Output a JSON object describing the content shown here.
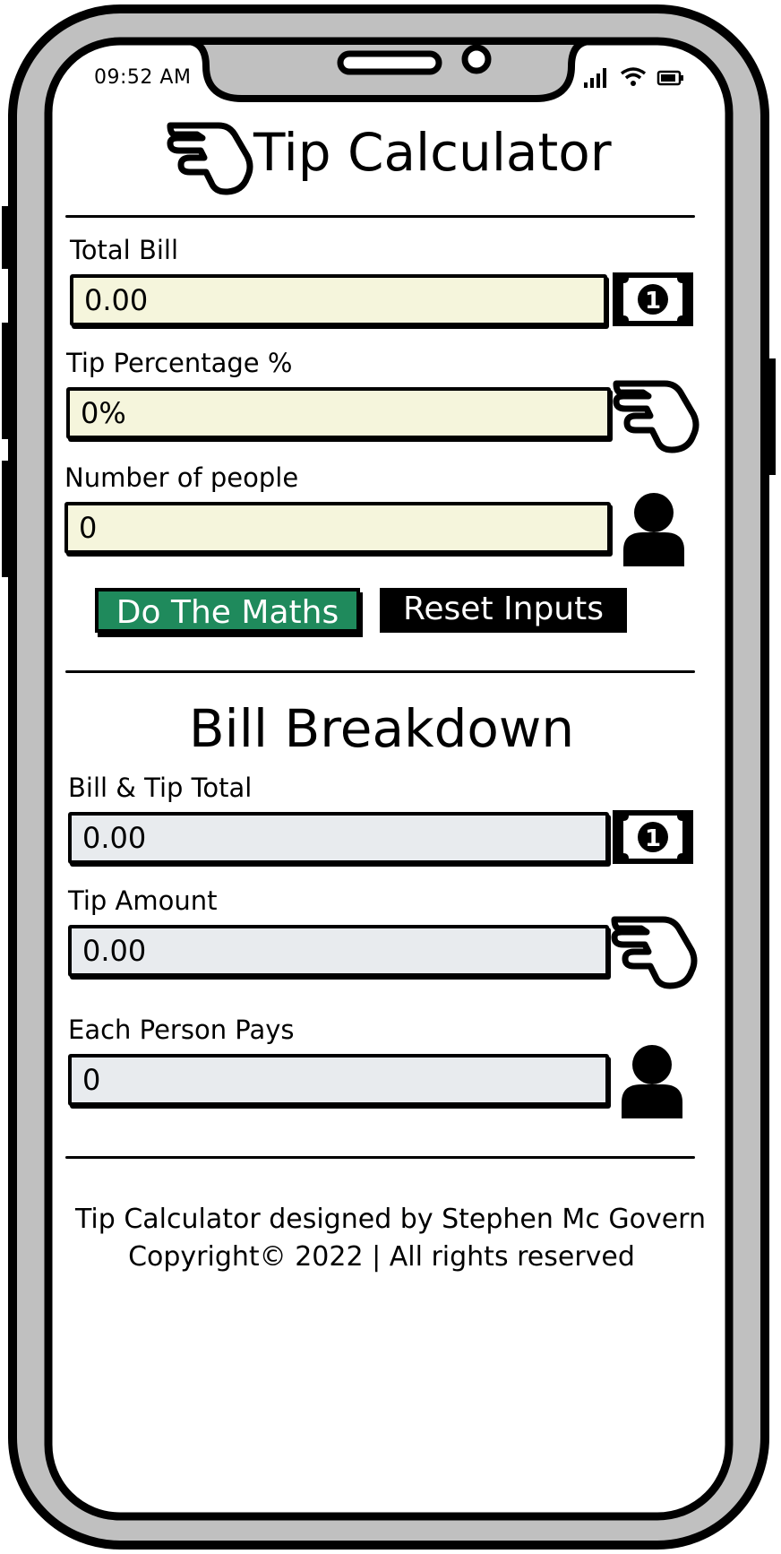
{
  "status_bar": {
    "time": "09:52 AM"
  },
  "header": {
    "title": "Tip Calculator"
  },
  "inputs": {
    "total_bill": {
      "label": "Total Bill",
      "value": "0.00"
    },
    "tip_percentage": {
      "label": "Tip Percentage %",
      "value": "0%"
    },
    "number_of_people": {
      "label": "Number of people",
      "value": "0"
    }
  },
  "buttons": {
    "calculate": "Do The Maths",
    "reset": "Reset Inputs"
  },
  "breakdown": {
    "title": "Bill Breakdown",
    "bill_tip_total": {
      "label": "Bill & Tip Total",
      "value": "0.00"
    },
    "tip_amount": {
      "label": "Tip Amount",
      "value": "0.00"
    },
    "each_person_pays": {
      "label": "Each Person Pays",
      "value": "0"
    }
  },
  "footer": {
    "line1": "Tip Calculator designed by Stephen Mc Govern",
    "line2": "Copyright© 2022 | All rights reserved"
  },
  "colors": {
    "input_bg": "#f5f5dc",
    "output_bg": "#e8ebee",
    "accent": "#1f8a5c",
    "phone_frame": "#c0c0c0"
  },
  "icons": [
    "hand-icon",
    "banknote-icon",
    "person-icon",
    "signal-icon",
    "wifi-icon",
    "battery-icon"
  ]
}
